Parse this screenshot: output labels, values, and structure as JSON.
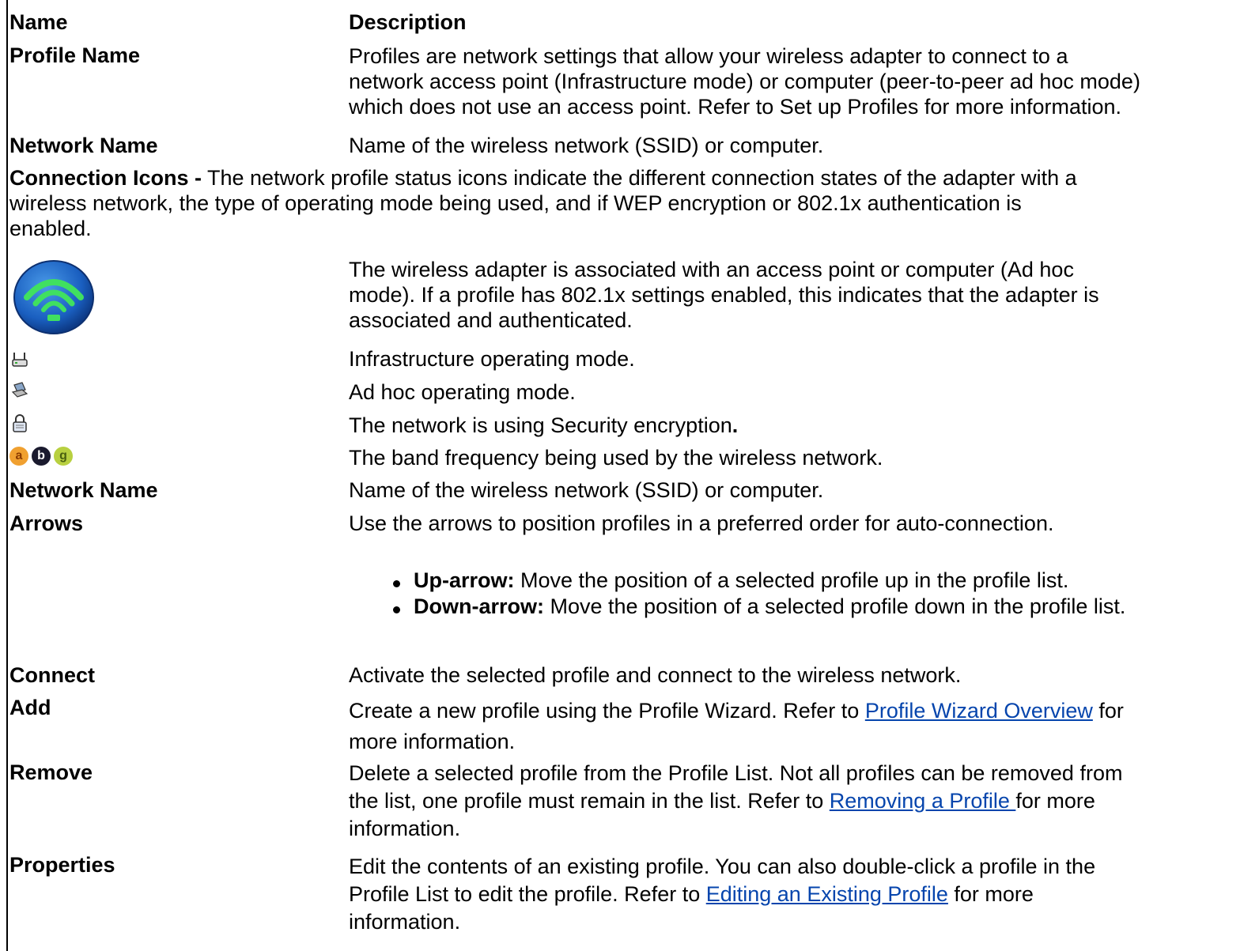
{
  "header": {
    "name": "Name",
    "description": "Description"
  },
  "rows": {
    "profile_name": {
      "label": "Profile Name",
      "desc": [
        "Profiles are network settings that allow your wireless adapter to connect to a",
        "network access point (Infrastructure mode) or computer (peer-to-peer ad hoc mode)",
        "which does not use an access point. Refer to Set up Profiles for more information."
      ]
    },
    "network_name": {
      "label": "Network Name",
      "desc": "Name of the wireless network (SSID) or computer."
    },
    "connection_icons": {
      "label": "Connection Icons -",
      "desc": [
        " The network profile status icons indicate the different connection states of the adapter with a",
        "wireless network, the type of operating mode being used, and if WEP encryption or 802.1x authentication is",
        "enabled."
      ]
    },
    "associated": {
      "icon": "wireless-associated-icon",
      "desc": [
        "The wireless adapter is associated with an access point or computer (Ad hoc",
        "mode). If a profile has 802.1x settings enabled, this indicates that the adapter is",
        "associated and authenticated."
      ]
    },
    "infrastructure": {
      "icon": "access-point-icon",
      "desc": "Infrastructure operating mode."
    },
    "adhoc": {
      "icon": "laptop-icon",
      "desc": "Ad hoc operating mode."
    },
    "security": {
      "icon": "lock-icon",
      "desc": "The network is using Security encryption",
      "suffix": "."
    },
    "band": {
      "icons": [
        "a",
        "b",
        "g"
      ],
      "colors": {
        "a": "#f0a030",
        "b": "#1a1a2e",
        "g": "#b8d040"
      },
      "desc": "The band frequency being used by the wireless network."
    },
    "network_name_2": {
      "label": "Network Name",
      "desc": "Name of the wireless network (SSID) or computer."
    },
    "arrows": {
      "label": "Arrows",
      "desc": "Use the arrows to position profiles in a preferred order for auto-connection.",
      "items": [
        {
          "term": "Up-arrow:",
          "text": " Move the position of a selected profile up in the profile list."
        },
        {
          "term": "Down-arrow:",
          "text": " Move the position of a selected profile down in the profile list."
        }
      ]
    },
    "connect": {
      "label": "Connect",
      "desc": "Activate the selected profile and connect to the wireless network."
    },
    "add": {
      "label": "Add",
      "desc_before": "Create a new profile using the Profile Wizard. Refer to ",
      "link": "Profile Wizard Overview",
      "desc_after": " for",
      "desc_line2": "more information."
    },
    "remove": {
      "label": "Remove",
      "line1": "Delete a selected profile from the Profile List. Not all profiles can be removed from",
      "desc_before": "the list, one profile must remain in the list. Refer to ",
      "link": "Removing a Profile ",
      "desc_after": "for more",
      "desc_line3": "information."
    },
    "properties": {
      "label": "Properties",
      "line1": "Edit the contents of an existing profile. You can also double-click a profile in the",
      "desc_before": "Profile List to edit the profile. Refer to ",
      "link": "Editing an Existing Profile",
      "desc_after": " for more",
      "desc_line3": "information."
    }
  },
  "colors": {
    "link": "#0645ad",
    "icon_blue": "#1a5fc0",
    "icon_green": "#40e060"
  }
}
